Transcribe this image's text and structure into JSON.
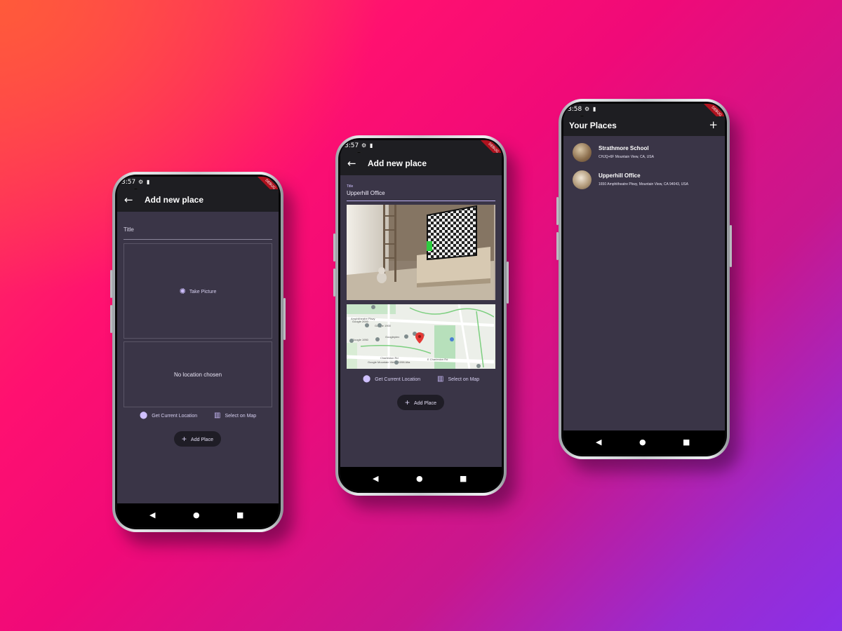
{
  "phones": [
    {
      "status_time": "3:57",
      "debug_label": "DEBUG",
      "appbar_title": "Add new place",
      "title_label": "Title",
      "take_picture_label": "Take Picture",
      "no_location_text": "No location chosen",
      "get_location_label": "Get Current Location",
      "select_map_label": "Select on Map",
      "add_place_label": "Add Place"
    },
    {
      "status_time": "3:57",
      "debug_label": "DEBUG",
      "appbar_title": "Add new place",
      "title_label": "Title",
      "title_value": "Upperhill Office",
      "map_labels": [
        "Amphitheatre Pkwy",
        "Google 1900",
        "Google 2000",
        "Google 1950",
        "Googleplex",
        "Charleston Rd",
        "E Charleston Rd",
        "Google Mountain View - 1098 Alta"
      ],
      "get_location_label": "Get Current Location",
      "select_map_label": "Select on Map",
      "add_place_label": "Add Place"
    },
    {
      "status_time": "3:58",
      "debug_label": "DEBUG",
      "appbar_title": "Your Places",
      "add_icon": "plus-icon",
      "places": [
        {
          "title": "Strathmore School",
          "address": "CHJQ+6F Mountain View, CA, USA"
        },
        {
          "title": "Upperhill Office",
          "address": "1650 Amphitheatre Pkwy, Mountain View, CA 94043, USA"
        }
      ]
    }
  ],
  "colors": {
    "accent": "#cfc0ff",
    "app_background": "#3a3547",
    "appbar": "#1e1e22",
    "map_pin": "#e53935"
  }
}
